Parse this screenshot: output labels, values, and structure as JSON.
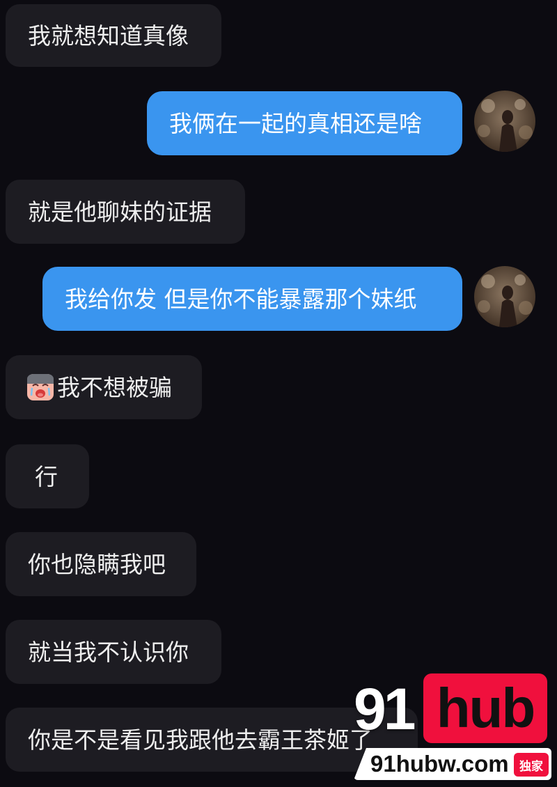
{
  "messages": [
    {
      "side": "incoming",
      "text": "我就想知道真像"
    },
    {
      "side": "outgoing",
      "text": "我俩在一起的真相还是啥"
    },
    {
      "side": "incoming",
      "text": "就是他聊妹的证据"
    },
    {
      "side": "outgoing",
      "text": "我给你发 但是你不能暴露那个妹纸"
    },
    {
      "side": "incoming",
      "text": "我不想被骗",
      "emoji": "crying-face-emoji"
    },
    {
      "side": "incoming",
      "text": "行"
    },
    {
      "side": "incoming",
      "text": "你也隐瞒我吧"
    },
    {
      "side": "incoming",
      "text": "就当我不认识你"
    },
    {
      "side": "incoming",
      "text": "你是不是看见我跟他去霸王茶姬了"
    }
  ],
  "watermark": {
    "brand_number": "91",
    "brand_word": "hub",
    "url": "91hubw.com",
    "badge": "独家"
  },
  "colors": {
    "background": "#0c0b11",
    "incoming_bubble": "#1d1c22",
    "outgoing_bubble": "#3a95ef",
    "watermark_accent": "#f0103d"
  }
}
